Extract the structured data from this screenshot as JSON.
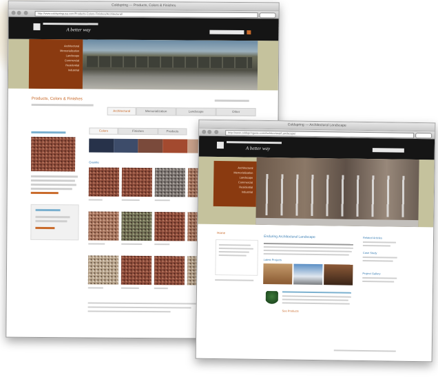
{
  "back_window": {
    "titlebar": "Coldspring — Products, Colors & Finishes",
    "url": "http://www.coldspringusa.com/Products-Colors-Finishes/Architectural/",
    "logo_tagline": "A better way",
    "menu_items": [
      "Architectural",
      "Memorialization",
      "Landscape",
      "Commercial",
      "Residential",
      "Industrial"
    ],
    "page_title": "Products, Colors & Finishes",
    "tabs": [
      "Architectural",
      "Memorialization",
      "Landscape",
      "Other"
    ],
    "sub_tabs": [
      "Colors",
      "Finishes",
      "Products"
    ],
    "section_label": "Granite",
    "colors": {
      "granite_swatches": [
        "g-red",
        "g-red",
        "g-grey",
        "g-pink",
        "g-pink",
        "g-green",
        "g-red",
        "g-pink",
        "g-tan",
        "g-red",
        "g-red",
        "g-tan"
      ],
      "color_band": [
        "#27324a",
        "#3d4c6a",
        "#7a4a3b",
        "#a34a2f",
        "#c7a18a",
        "#d9d1bc",
        "#c4c2a2"
      ]
    }
  },
  "front_window": {
    "titlebar": "Coldspring — Architectural Landscape",
    "url": "http://www.coldspringusa.com/Architectural/Landscape/",
    "logo_tagline": "A better way",
    "menu_items": [
      "Architectural",
      "Memorialization",
      "Landscape",
      "Commercial",
      "Residential",
      "Industrial"
    ],
    "breadcrumb": "Home",
    "heading": "Enduring Architectural Landscape",
    "sub_link": "Latest Projects",
    "right_links": [
      "Related Articles",
      "Case Study",
      "Project Gallery"
    ],
    "bottom_link": "See Products",
    "colors": {
      "accent": "#c96a2a",
      "link": "#3b7fb4"
    }
  }
}
